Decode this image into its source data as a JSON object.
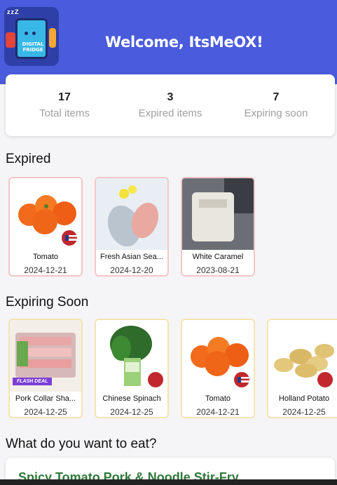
{
  "header": {
    "welcome": "Welcome, ItsMeOX!",
    "logo_text": "DIGITAL FRIDGE",
    "logo_zzz": "zzZ",
    "bg_color": "#4a5bdc"
  },
  "stats": [
    {
      "value": "17",
      "label": "Total items"
    },
    {
      "value": "3",
      "label": "Expired items"
    },
    {
      "value": "7",
      "label": "Expiring soon"
    }
  ],
  "sections": {
    "expired_title": "Expired",
    "soon_title": "Expiring Soon",
    "eat_title": "What do you want to eat?"
  },
  "expired_items": [
    {
      "name": "Tomato",
      "date": "2024-12-21",
      "image": "tomato"
    },
    {
      "name": "Fresh Asian Sea...",
      "date": "2024-12-20",
      "image": "sea-bass"
    },
    {
      "name": "White Caramel",
      "date": "2023-08-21",
      "image": "white-caramel"
    }
  ],
  "soon_items": [
    {
      "name": "Pork Collar Sha...",
      "date": "2024-12-25",
      "image": "pork",
      "badge_text": "FLASH DEAL"
    },
    {
      "name": "Chinese Spinach",
      "date": "2024-12-25",
      "image": "spinach"
    },
    {
      "name": "Tomato",
      "date": "2024-12-21",
      "image": "tomato"
    },
    {
      "name": "Holland Potato",
      "date": "2024-12-25",
      "image": "potato"
    }
  ],
  "recipe": {
    "title": "Spicy Tomato Pork & Noodle Stir-Fry"
  },
  "colors": {
    "expired_border": "#f5c6c6",
    "soon_border": "#f5e3b0",
    "recipe_text": "#2f7a3a"
  }
}
